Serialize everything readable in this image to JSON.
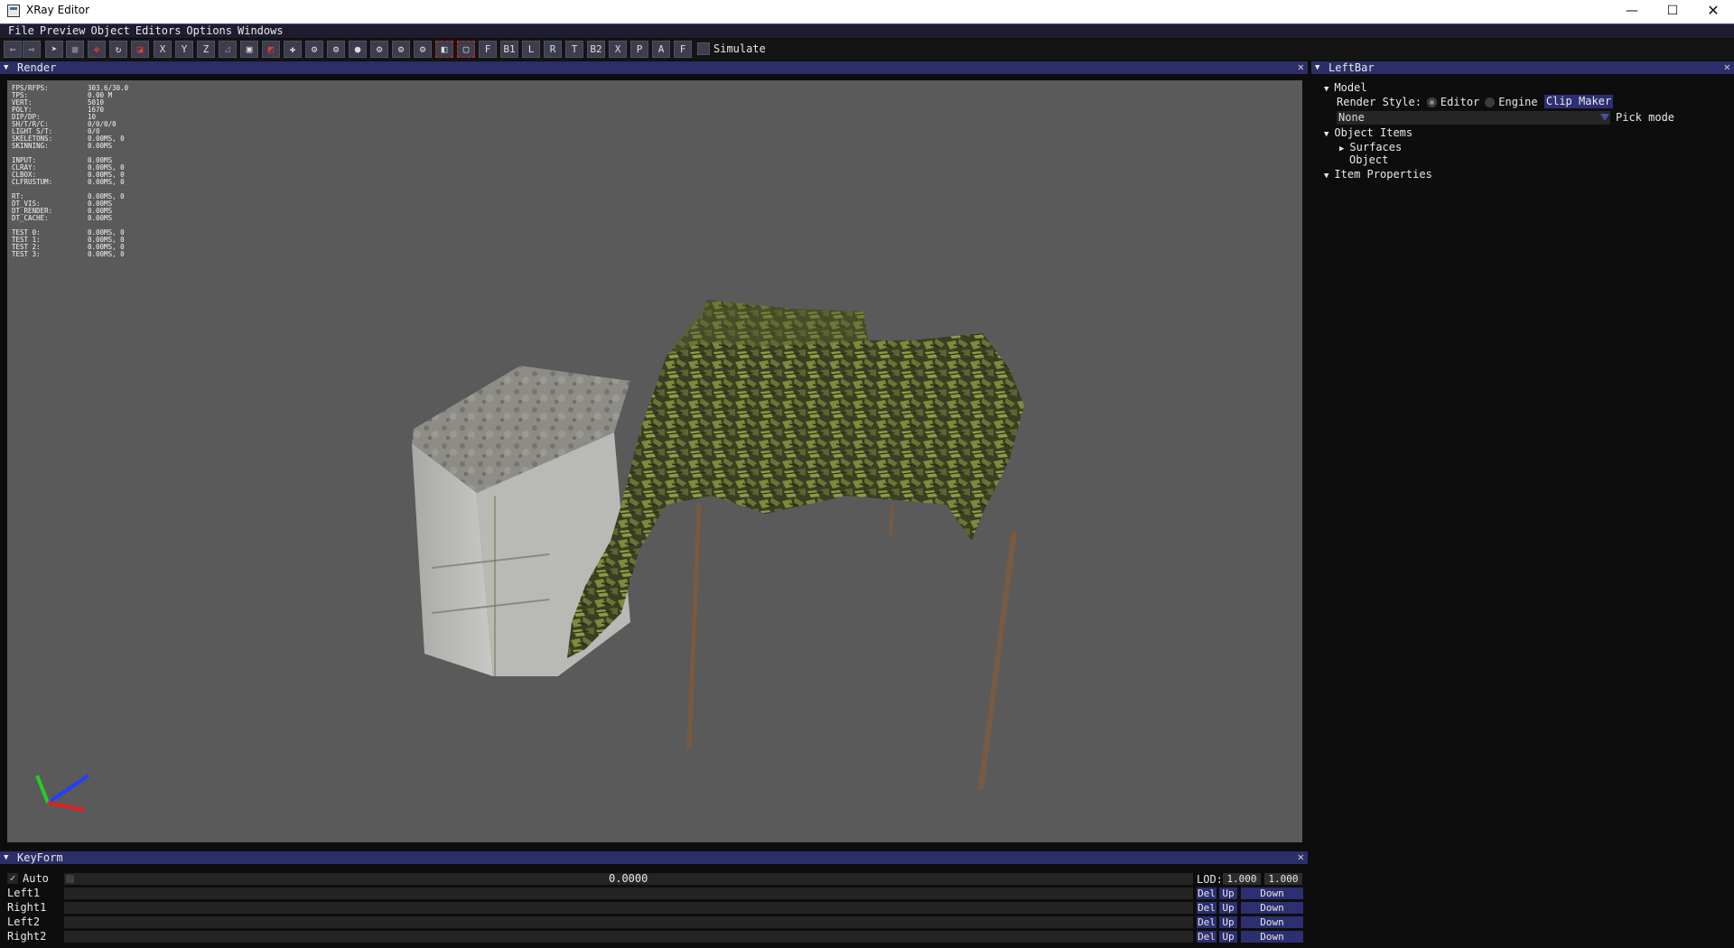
{
  "window": {
    "title": "XRay Editor",
    "minimize": "—",
    "maximize": "☐",
    "close": "✕"
  },
  "menu": [
    "File",
    "Preview",
    "Object",
    "Editors",
    "Options",
    "Windows"
  ],
  "toolbar": {
    "text_buttons": [
      "X",
      "Y",
      "Z",
      "F",
      "B1",
      "L",
      "R",
      "T",
      "B2",
      "X",
      "P",
      "A",
      "F"
    ],
    "simulate_label": "Simulate",
    "simulate_checked": false
  },
  "render_panel": {
    "title": "Render",
    "close": "✕",
    "stats": [
      [
        "FPS/RFPS:",
        "303.6/30.0"
      ],
      [
        "TPS:",
        "0.00 M"
      ],
      [
        "VERT:",
        "5010"
      ],
      [
        "POLY:",
        "1670"
      ],
      [
        "DIP/DP:",
        "10"
      ],
      [
        "SH/T/R/C:",
        "0/0/0/0"
      ],
      [
        "LIGHT S/T:",
        "0/0"
      ],
      [
        "SKELETONS:",
        "0.00MS, 0"
      ],
      [
        "SKINNING:",
        "0.00MS"
      ],
      [
        "",
        ""
      ],
      [
        "INPUT:",
        "0.00MS"
      ],
      [
        "CLRAY:",
        "0.00MS, 0"
      ],
      [
        "CLBOX:",
        "0.00MS, 0"
      ],
      [
        "CLFRUSTUM:",
        "0.00MS, 0"
      ],
      [
        "",
        ""
      ],
      [
        " RT:",
        "0.00MS, 0"
      ],
      [
        " DT_VIS:",
        "0.00MS"
      ],
      [
        " DT_RENDER:",
        "0.00MS"
      ],
      [
        " DT_CACHE:",
        "0.00MS"
      ],
      [
        "",
        ""
      ],
      [
        "TEST 0:",
        "0.00MS, 0"
      ],
      [
        "TEST 1:",
        "0.00MS, 0"
      ],
      [
        "TEST 2:",
        "0.00MS, 0"
      ],
      [
        "TEST 3:",
        "0.00MS, 0"
      ]
    ]
  },
  "leftbar": {
    "title": "LeftBar",
    "close": "✕",
    "model_label": "Model",
    "render_style_label": "Render Style:",
    "render_style_options": [
      "Editor",
      "Engine"
    ],
    "render_style_selected": "Editor",
    "clip_maker_button": "Clip Maker",
    "pick_select_value": "None",
    "pick_mode_label": "Pick mode",
    "object_items_label": "Object Items",
    "surfaces_label": "Surfaces",
    "object_label": "Object",
    "item_properties_label": "Item Properties"
  },
  "keyform": {
    "title": "KeyForm",
    "close": "✕",
    "auto_label": "Auto",
    "auto_checked": true,
    "time_value": "0.0000",
    "lod_label": "LOD:",
    "lod_values": [
      "1.000",
      "1.000"
    ],
    "rows": [
      {
        "label": "Left1",
        "del": "Del",
        "up": "Up",
        "down": "Down"
      },
      {
        "label": "Right1",
        "del": "Del",
        "up": "Up",
        "down": "Down"
      },
      {
        "label": "Left2",
        "del": "Del",
        "up": "Up",
        "down": "Down"
      },
      {
        "label": "Right2",
        "del": "Del",
        "up": "Up",
        "down": "Down"
      }
    ]
  },
  "colors": {
    "panel_header": "#2b2e68",
    "button": "#2c2f70",
    "viewport_bg": "#5a5a5a",
    "camo_green": "#6f7a3a",
    "concrete": "#8a8a86"
  }
}
